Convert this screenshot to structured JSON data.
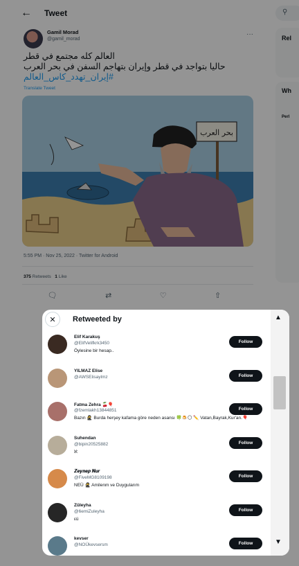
{
  "header": {
    "back_icon": "arrow-left-icon",
    "title": "Tweet"
  },
  "tweet": {
    "author_name": "Gamil Morad",
    "author_handle": "@gamil_morad",
    "line1": "العالم كله مجتمع في قطر",
    "line2": "حاليا بتواجد في قطر وإيران بتهاجم السفن في بحر العرب",
    "hashtag": "#إيران_تهدد_كاس_العالم",
    "translate": "Translate Tweet",
    "image_sign_text": "بحر العرب",
    "meta": "5:55 PM · Nov 25, 2022 · Twitter for Android",
    "retweets_count": "375",
    "retweets_label": "Retweets",
    "likes_count": "1",
    "likes_label": "Like"
  },
  "sidebar": {
    "relevant_title": "Rel",
    "whats_title": "Wh",
    "trend_text": "Perl"
  },
  "modal": {
    "title": "Retweeted by",
    "follow_label": "Follow",
    "users": [
      {
        "name": "Elif Karakuş",
        "handle": "@ElifVelifkrk3450",
        "bio": "Öylesine bir hesap..",
        "avatar_color": "#3a2a22"
      },
      {
        "name": "YILMAZ Elise",
        "handle": "@AWSElisaylmz",
        "bio": "",
        "avatar_color": "#b99677"
      },
      {
        "name": "Fatma Zehra 🍒🎈",
        "handle": "@fzemlakh13844851",
        "bio": "Bazın 🥷 Burda herşey kafama göre neden asansı 🍀🍮🌕 ✏️ Vatan,Bayrak,Kur'an.🎈",
        "avatar_color": "#a8706a"
      },
      {
        "name": "Suhendan",
        "handle": "@bipin20525882",
        "bio": "ℵ",
        "avatar_color": "#b7ad9a"
      },
      {
        "name": "𝒁𝒆𝒚𝒏𝒆𝒑 𝑵𝒖𝒓",
        "handle": "@FiveMG8109198",
        "bio": "NEÜ 🥷 Amilenm ve Duygularım",
        "avatar_color": "#d68a4a"
      },
      {
        "name": "Züleyha",
        "handle": "@6emiZuleyha",
        "bio": "εü",
        "avatar_color": "#262626"
      },
      {
        "name": "kevser",
        "handle": "@NOÜkevsersm",
        "bio": "",
        "avatar_color": "#5a7a8a"
      }
    ]
  }
}
